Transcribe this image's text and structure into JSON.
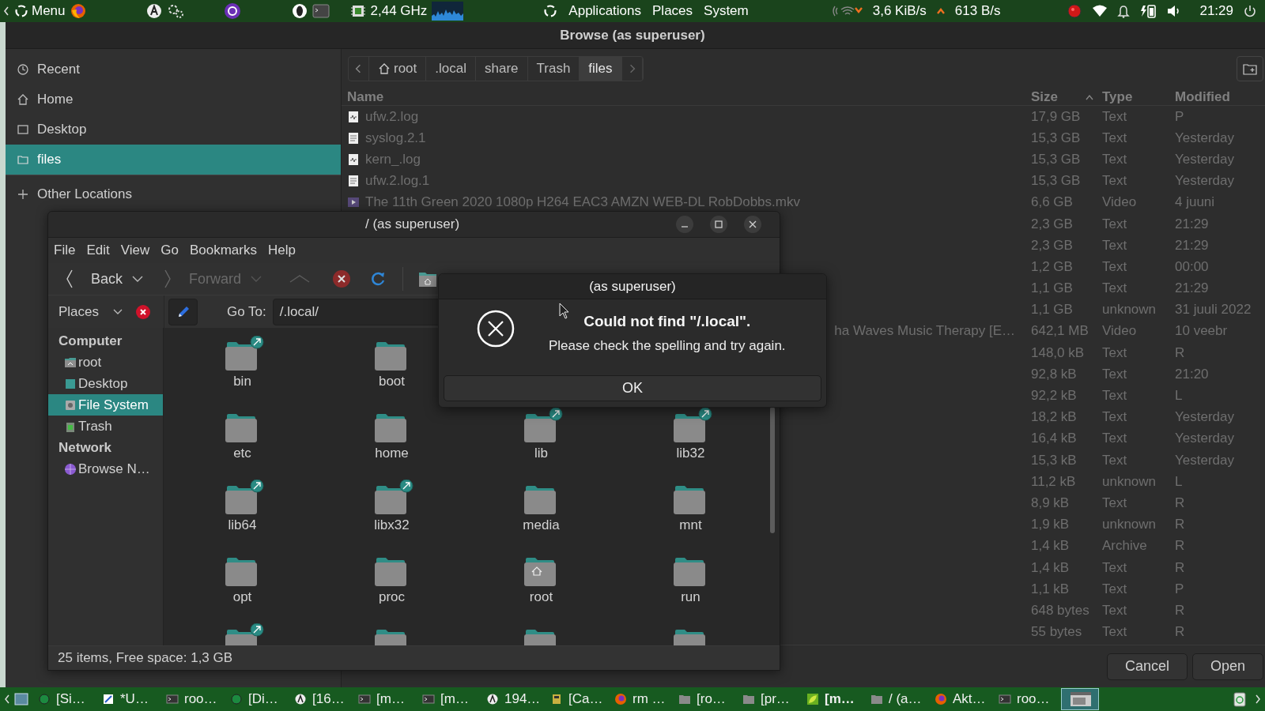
{
  "top_panel": {
    "menu_label": "Menu",
    "cpu_freq": "2,44 GHz",
    "menus": [
      "Applications",
      "Places",
      "System"
    ],
    "net_down": "3,6 KiB/s",
    "net_up": "613 B/s",
    "clock": "21:29"
  },
  "file_chooser": {
    "title": "Browse (as superuser)",
    "places": [
      {
        "label": "Recent",
        "kind": "recent",
        "selected": false
      },
      {
        "label": "Home",
        "kind": "home",
        "selected": false
      },
      {
        "label": "Desktop",
        "kind": "desktop",
        "selected": false
      },
      {
        "label": "files",
        "kind": "folder",
        "selected": true
      },
      {
        "label": "Other Locations",
        "kind": "other",
        "selected": false
      }
    ],
    "path": [
      {
        "label": "root",
        "kind": "home",
        "selected": false
      },
      {
        "label": ".local",
        "kind": "folder",
        "selected": false
      },
      {
        "label": "share",
        "kind": "folder",
        "selected": false
      },
      {
        "label": "Trash",
        "kind": "folder",
        "selected": false
      },
      {
        "label": "files",
        "kind": "folder",
        "selected": true
      }
    ],
    "columns": [
      {
        "label": "Name",
        "sorted": false
      },
      {
        "label": "Size",
        "sorted": true
      },
      {
        "label": "Type",
        "sorted": false
      },
      {
        "label": "Modified",
        "sorted": false
      }
    ],
    "rows": [
      {
        "name": "ufw.2.log",
        "kind": "log",
        "size": "17,9 GB",
        "type": "Text",
        "modified": "P"
      },
      {
        "name": "syslog.2.1",
        "kind": "text",
        "size": "15,3 GB",
        "type": "Text",
        "modified": "Yesterday"
      },
      {
        "name": "kern_.log",
        "kind": "log",
        "size": "15,3 GB",
        "type": "Text",
        "modified": "Yesterday"
      },
      {
        "name": "ufw.2.log.1",
        "kind": "text",
        "size": "15,3 GB",
        "type": "Text",
        "modified": "Yesterday"
      },
      {
        "name": "The 11th Green 2020 1080p H264 EAC3 AMZN WEB-DL RobDobbs.mkv",
        "kind": "video",
        "size": "6,6 GB",
        "type": "Video",
        "modified": "4 juuni"
      },
      {
        "size": "2,3 GB",
        "type": "Text",
        "modified": "21:29"
      },
      {
        "size": "2,3 GB",
        "type": "Text",
        "modified": "21:29"
      },
      {
        "size": "1,2 GB",
        "type": "Text",
        "modified": "00:00"
      },
      {
        "size": "1,1 GB",
        "type": "Text",
        "modified": "21:29"
      },
      {
        "size": "1,1 GB",
        "type": "unknown",
        "modified": "31 juuli 2022"
      },
      {
        "name": "ha Waves Music Therapy [E…",
        "name_covered": true,
        "size": "642,1 MB",
        "type": "Video",
        "modified": "10 veebr"
      },
      {
        "size": "148,0 kB",
        "type": "Text",
        "modified": "R"
      },
      {
        "size": "92,8 kB",
        "type": "Text",
        "modified": "21:20"
      },
      {
        "size": "92,2 kB",
        "type": "Text",
        "modified": "L"
      },
      {
        "size": "18,2 kB",
        "type": "Text",
        "modified": "Yesterday"
      },
      {
        "size": "16,4 kB",
        "type": "Text",
        "modified": "Yesterday"
      },
      {
        "size": "15,3 kB",
        "type": "Text",
        "modified": "Yesterday"
      },
      {
        "size": "11,2 kB",
        "type": "unknown",
        "modified": "L"
      },
      {
        "size": "8,9 kB",
        "type": "Text",
        "modified": "R"
      },
      {
        "size": "1,9 kB",
        "type": "unknown",
        "modified": "R"
      },
      {
        "size": "1,4 kB",
        "type": "Archive",
        "modified": "R"
      },
      {
        "size": "1,4 kB",
        "type": "Text",
        "modified": "R"
      },
      {
        "size": "1,1 kB",
        "type": "Text",
        "modified": "P"
      },
      {
        "size": "648 bytes",
        "type": "Text",
        "modified": "R"
      },
      {
        "size": "55 bytes",
        "type": "Text",
        "modified": "R"
      }
    ],
    "buttons": [
      "Cancel",
      "Open"
    ]
  },
  "browser_window": {
    "title": "/ (as superuser)",
    "menu": [
      "File",
      "Edit",
      "View",
      "Go",
      "Bookmarks",
      "Help"
    ],
    "toolbar": [
      {
        "kind": "back",
        "label": "Back",
        "disabled": false
      },
      {
        "kind": "forward",
        "label": "Forward",
        "disabled": true
      },
      {
        "kind": "up",
        "disabled": true
      },
      {
        "kind": "stop",
        "disabled": false
      },
      {
        "kind": "reload",
        "disabled": false
      },
      {
        "kind": "home",
        "disabled": false
      }
    ],
    "location": {
      "places_label": "Places",
      "goto_label": "Go To:",
      "path": "/.local/"
    },
    "sidebar": [
      {
        "kind": "heading",
        "label": "Computer"
      },
      {
        "kind": "home",
        "label": "root",
        "selected": false
      },
      {
        "kind": "desktop",
        "label": "Desktop",
        "selected": false
      },
      {
        "kind": "drive",
        "label": "File System",
        "selected": true
      },
      {
        "kind": "trash",
        "label": "Trash",
        "selected": false
      },
      {
        "kind": "heading",
        "label": "Network"
      },
      {
        "kind": "network",
        "label": "Browse N…",
        "selected": false
      }
    ],
    "icon_rows": [
      [
        {
          "label": "bin",
          "kind": "folder",
          "link": true
        },
        {
          "label": "boot",
          "kind": "folder",
          "link": false
        }
      ],
      [
        {
          "label": "etc",
          "kind": "folder",
          "link": false
        },
        {
          "label": "home",
          "kind": "folder",
          "link": false
        },
        {
          "label": "lib",
          "kind": "folder",
          "link": true
        },
        {
          "label": "lib32",
          "kind": "folder",
          "link": true
        }
      ],
      [
        {
          "label": "lib64",
          "kind": "folder",
          "link": true
        },
        {
          "label": "libx32",
          "kind": "folder",
          "link": true
        },
        {
          "label": "media",
          "kind": "folder",
          "link": false
        },
        {
          "label": "mnt",
          "kind": "folder",
          "link": false
        }
      ],
      [
        {
          "label": "opt",
          "kind": "folder",
          "link": false
        },
        {
          "label": "proc",
          "kind": "folder",
          "link": false
        },
        {
          "label": "root",
          "kind": "home",
          "link": false
        },
        {
          "label": "run",
          "kind": "folder",
          "link": false
        }
      ],
      [
        {
          "kind": "folder",
          "link": true
        },
        {
          "kind": "folder",
          "link": false
        },
        {
          "kind": "folder",
          "link": false
        },
        {
          "kind": "folder",
          "link": false
        }
      ]
    ],
    "status": "25 items, Free space: 1,3 GB"
  },
  "dialog": {
    "title": "(as superuser)",
    "heading": "Could not find \"/.local\".",
    "message": "Please check the spelling and try again.",
    "button": "OK"
  },
  "taskbar": {
    "items": [
      {
        "label": "[Si…",
        "kind": "round",
        "attention": false,
        "selected": false
      },
      {
        "label": "*U…",
        "kind": "note",
        "attention": false,
        "selected": false
      },
      {
        "label": "roo…",
        "kind": "terminal",
        "attention": false,
        "selected": false
      },
      {
        "label": "[Di…",
        "kind": "round",
        "attention": false,
        "selected": false
      },
      {
        "label": "[16…",
        "kind": "letter",
        "attention": false,
        "selected": false
      },
      {
        "label": "[m…",
        "kind": "terminal",
        "attention": false,
        "selected": false
      },
      {
        "label": "[m…",
        "kind": "terminal",
        "attention": false,
        "selected": false
      },
      {
        "label": "194…",
        "kind": "letter",
        "attention": false,
        "selected": false
      },
      {
        "label": "[Ca…",
        "kind": "book",
        "attention": false,
        "selected": false
      },
      {
        "label": "rm …",
        "kind": "fox",
        "attention": false,
        "selected": false
      },
      {
        "label": "[ro…",
        "kind": "folder",
        "attention": false,
        "selected": false
      },
      {
        "label": "[pr…",
        "kind": "folder",
        "attention": false,
        "selected": false
      },
      {
        "label": "[m…",
        "kind": "leaf",
        "attention": true,
        "selected": false
      },
      {
        "label": "/ (a…",
        "kind": "folder",
        "attention": false,
        "selected": false
      },
      {
        "label": "Akt…",
        "kind": "fox",
        "attention": false,
        "selected": false
      },
      {
        "label": "roo…",
        "kind": "terminal",
        "attention": false,
        "selected": false
      },
      {
        "kind": "window",
        "attention": false,
        "selected": true
      }
    ]
  }
}
